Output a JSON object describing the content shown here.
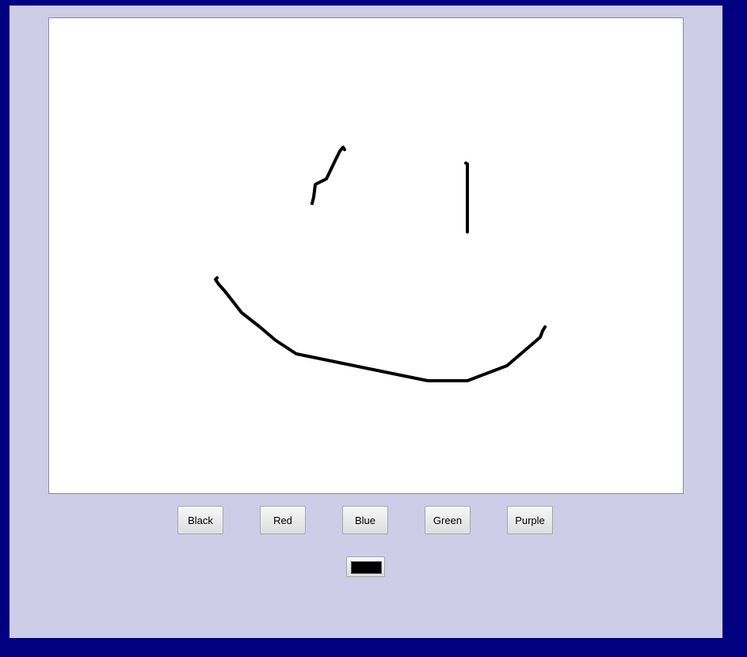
{
  "app": {
    "buttons": [
      {
        "label": "Black"
      },
      {
        "label": "Red"
      },
      {
        "label": "Blue"
      },
      {
        "label": "Green"
      },
      {
        "label": "Purple"
      }
    ],
    "current_color": "#000000",
    "background_color": "#000080",
    "panel_color": "#cdcde8",
    "canvas_color": "#ffffff"
  }
}
